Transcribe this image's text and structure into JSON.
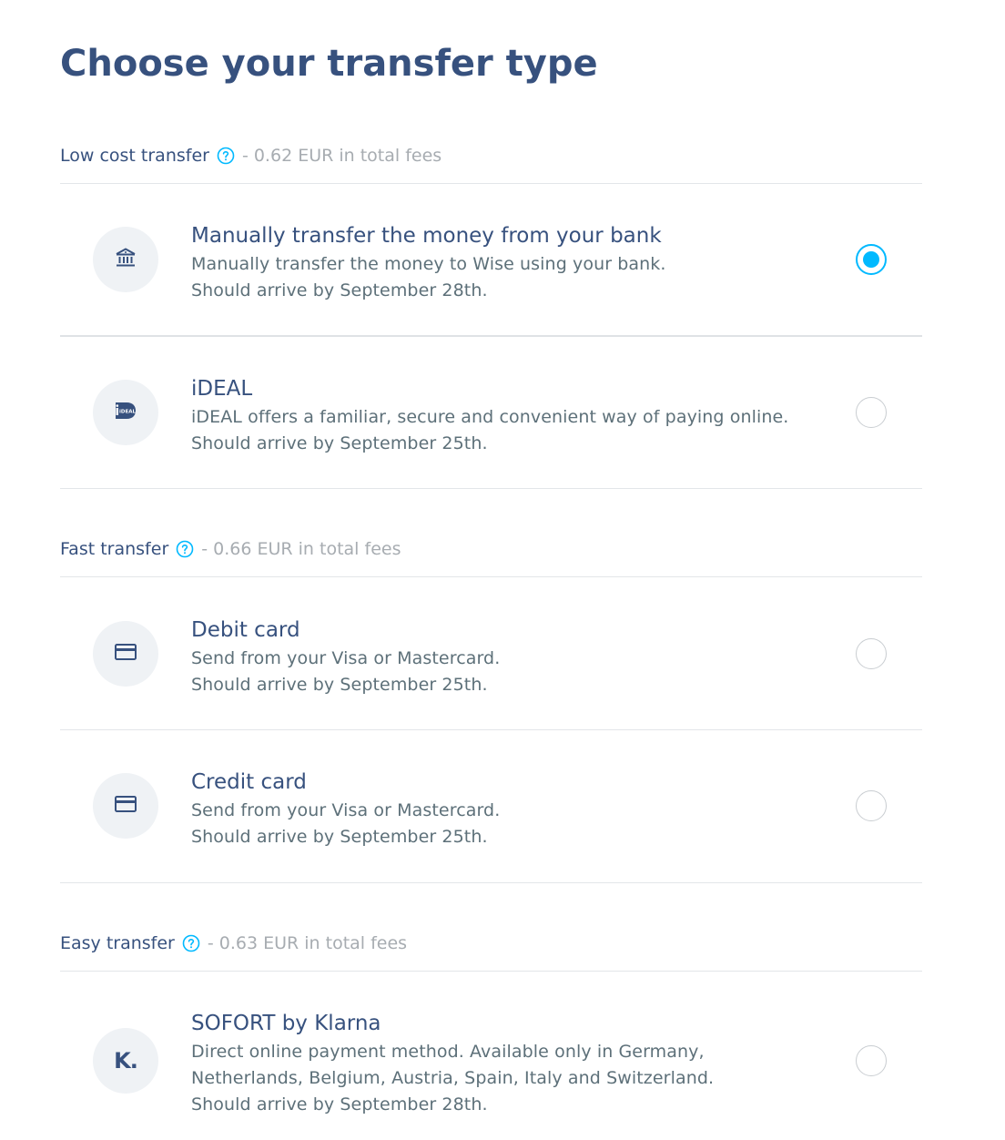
{
  "page": {
    "title": "Choose your transfer type"
  },
  "groups": [
    {
      "name": "Low cost transfer",
      "fees": "- 0.62 EUR in total fees",
      "options": [
        {
          "icon": "bank-icon",
          "title": "Manually transfer the money from your bank",
          "description": "Manually transfer the money to Wise using your bank.",
          "arrival": "Should arrive by September 28th.",
          "selected": true
        },
        {
          "icon": "ideal-icon",
          "icon_text": "iDEAL",
          "title": "iDEAL",
          "description": "iDEAL offers a familiar, secure and convenient way of paying online.",
          "arrival": "Should arrive by September 25th.",
          "selected": false
        }
      ]
    },
    {
      "name": "Fast transfer",
      "fees": "- 0.66 EUR in total fees",
      "options": [
        {
          "icon": "card-icon",
          "title": "Debit card",
          "description": "Send from your Visa or Mastercard.",
          "arrival": "Should arrive by September 25th.",
          "selected": false
        },
        {
          "icon": "card-icon",
          "title": "Credit card",
          "description": "Send from your Visa or Mastercard.",
          "arrival": "Should arrive by September 25th.",
          "selected": false
        }
      ]
    },
    {
      "name": "Easy transfer",
      "fees": "- 0.63 EUR in total fees",
      "options": [
        {
          "icon": "klarna-icon",
          "icon_text": "K.",
          "title": "SOFORT by Klarna",
          "description_lines": [
            "Direct online payment method. Available only in Germany,",
            "Netherlands, Belgium, Austria, Spain, Italy and Switzerland."
          ],
          "arrival": "Should arrive by September 28th.",
          "selected": false
        }
      ]
    }
  ],
  "colors": {
    "heading": "#37517e",
    "body_text": "#5d7079",
    "muted": "#a7acb1",
    "accent": "#00b9ff",
    "icon_bg": "#eff2f5",
    "divider": "#e3e6e9"
  }
}
